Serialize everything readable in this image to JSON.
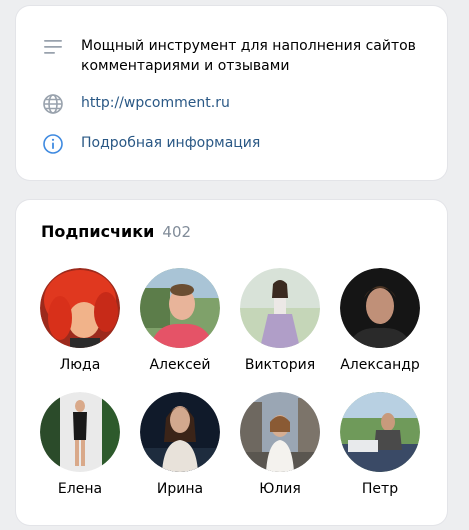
{
  "info": {
    "description": "Мощный инструмент для наполнения сайтов комментариями и отзывами",
    "website": "http://wpcomment.ru",
    "more_info": "Подробная информация"
  },
  "followers": {
    "title": "Подписчики",
    "count": "402",
    "people": [
      {
        "name": "Люда"
      },
      {
        "name": "Алексей"
      },
      {
        "name": "Виктория"
      },
      {
        "name": "Александр"
      },
      {
        "name": "Елена"
      },
      {
        "name": "Ирина"
      },
      {
        "name": "Юлия"
      },
      {
        "name": "Петр"
      }
    ]
  },
  "colors": {
    "link": "#2a5885",
    "icon": "#99a2ad",
    "info_icon": "#3f8ae0",
    "count": "#818c99",
    "background": "#edeef0"
  }
}
